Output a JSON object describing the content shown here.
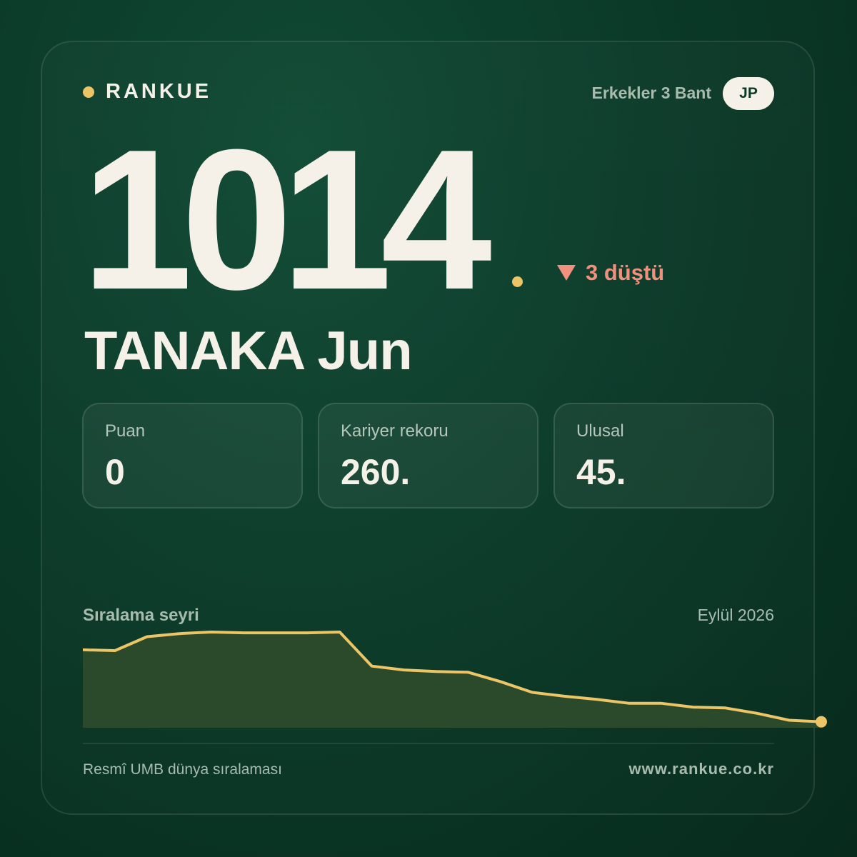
{
  "brand": {
    "name": "RANKUE",
    "accent": "#ecc567"
  },
  "header": {
    "category": "Erkekler 3 Bant",
    "country_code": "JP"
  },
  "rank": {
    "value": "1014",
    "change_text": "3 düştü",
    "change_direction": "down",
    "change_color": "#f0907e"
  },
  "player": {
    "name": "TANAKA Jun"
  },
  "stats": [
    {
      "label": "Puan",
      "value": "0"
    },
    {
      "label": "Kariyer rekoru",
      "value": "260."
    },
    {
      "label": "Ulusal",
      "value": "45."
    }
  ],
  "chart": {
    "title": "Sıralama seyri",
    "date": "Eylül 2026"
  },
  "chart_data": {
    "type": "area",
    "title": "Sıralama seyri",
    "note": "Rank trend (lower line = worse rank). Values estimated; no axis labels shown.",
    "y_inverted": true,
    "values": [
      928,
      929,
      911,
      907,
      905,
      906,
      906,
      906,
      905,
      949,
      954,
      956,
      957,
      969,
      983,
      988,
      992,
      997,
      997,
      1002,
      1003,
      1010,
      1019,
      1021
    ],
    "ylim": [
      905,
      1025
    ],
    "line_color": "#ecc567",
    "fill_color": "#2b4a2b",
    "grid": false,
    "legend": "none"
  },
  "footer": {
    "source": "Resmî UMB dünya sıralaması",
    "url": "www.rankue.co.kr"
  }
}
